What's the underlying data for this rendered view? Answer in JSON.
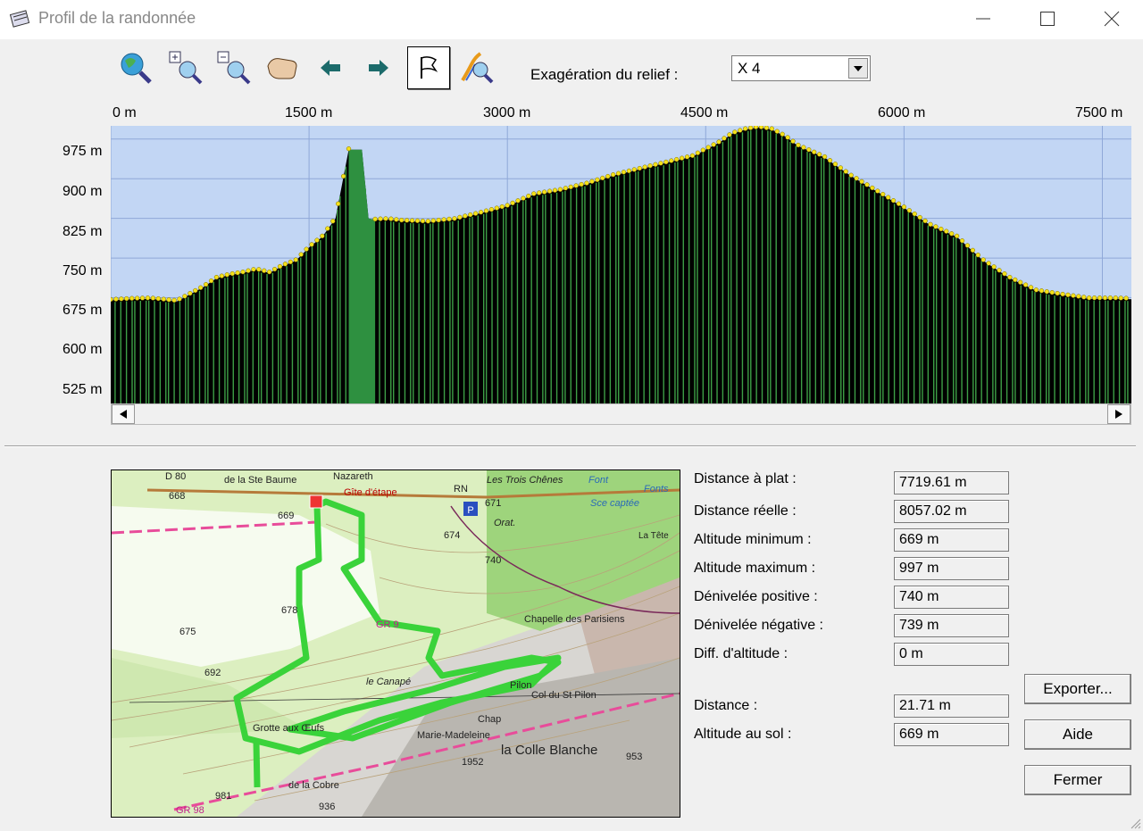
{
  "window": {
    "title": "Profil de la randonnée"
  },
  "toolbar": {
    "buttons": [
      "zoom-extent-icon",
      "zoom-in-icon",
      "zoom-out-icon",
      "pan-hand-icon",
      "arrow-left-icon",
      "arrow-right-icon",
      "flag-icon",
      "profile-route-icon"
    ],
    "relief_label": "Exagération du relief :",
    "relief_value": "X 4"
  },
  "chart_data": {
    "type": "area",
    "x_ticks": [
      "0 m",
      "1500 m",
      "3000 m",
      "4500 m",
      "6000 m",
      "7500 m"
    ],
    "y_ticks": [
      "975 m",
      "900 m",
      "825 m",
      "750 m",
      "675 m",
      "600 m",
      "525 m"
    ],
    "xlim": [
      0,
      7719.61
    ],
    "ylim": [
      475,
      1000
    ],
    "grid": true,
    "colors": {
      "sky": "#c2d6f4",
      "ground": "#000000",
      "stripes": "#3d9f46",
      "highlight": "#2e9040",
      "dots": "#f5e11a",
      "grid": "#8fa8d8"
    },
    "x": [
      0,
      150,
      300,
      500,
      700,
      800,
      900,
      1000,
      1100,
      1200,
      1300,
      1400,
      1500,
      1600,
      1700,
      1800,
      1850,
      1900,
      1950,
      2000,
      2100,
      2200,
      2400,
      2600,
      2800,
      3000,
      3200,
      3400,
      3600,
      3800,
      4000,
      4200,
      4400,
      4600,
      4700,
      4800,
      4900,
      5000,
      5100,
      5200,
      5400,
      5600,
      5800,
      6000,
      6200,
      6400,
      6600,
      6800,
      7000,
      7200,
      7400,
      7600,
      7719.61
    ],
    "y": [
      670,
      672,
      673,
      668,
      695,
      712,
      718,
      722,
      728,
      722,
      735,
      745,
      770,
      790,
      825,
      955,
      955,
      955,
      825,
      822,
      823,
      820,
      818,
      823,
      835,
      848,
      870,
      878,
      890,
      906,
      918,
      930,
      942,
      968,
      985,
      993,
      997,
      993,
      980,
      962,
      940,
      905,
      875,
      845,
      812,
      790,
      745,
      712,
      688,
      680,
      673,
      673,
      672
    ]
  },
  "map": {
    "labels": [
      "de la Ste Baume",
      "Nazareth",
      "RN",
      "Les Trois Chênes",
      "Font",
      "Gîte d'étape",
      "Orat.",
      "Chapelle des Parisiens",
      "le Canapé",
      "Col du St Pilon",
      "Marie-Madeleine",
      "la Colle Blanche",
      "Grotte aux Œufs",
      "de la Cobre",
      "GR 98",
      "GR 9",
      "674",
      "740",
      "678",
      "675",
      "692",
      "669",
      "668",
      "671",
      "1952",
      "953",
      "936",
      "981",
      "D 80",
      "Sce captée",
      "Fonts",
      "Pilon",
      "Chap",
      "La Tête"
    ]
  },
  "stats": [
    {
      "label": "Distance à plat :",
      "value": "7719.61 m"
    },
    {
      "label": "Distance réelle :",
      "value": "8057.02 m"
    },
    {
      "label": "Altitude minimum :",
      "value": "669 m"
    },
    {
      "label": "Altitude maximum :",
      "value": "997 m"
    },
    {
      "label": "Dénivelée positive :",
      "value": "740 m"
    },
    {
      "label": "Dénivelée négative :",
      "value": "739 m"
    },
    {
      "label": "Diff. d'altitude :",
      "value": "0 m"
    }
  ],
  "cursor": [
    {
      "label": "Distance :",
      "value": "21.71 m"
    },
    {
      "label": "Altitude au sol :",
      "value": "669 m"
    }
  ],
  "buttons": {
    "export": "Exporter...",
    "help": "Aide",
    "close": "Fermer"
  }
}
